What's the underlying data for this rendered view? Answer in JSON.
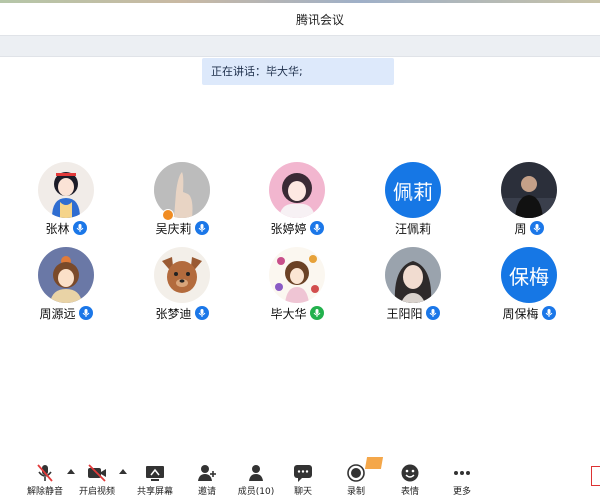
{
  "window": {
    "title": "腾讯会议"
  },
  "speaking": {
    "label": "正在讲话：",
    "names": "毕大华;"
  },
  "participants": [
    {
      "name": "张林",
      "avatar_type": "image",
      "avatar_desc": "cartoon-princess-icon",
      "mic": "on"
    },
    {
      "name": "吴庆莉",
      "avatar_type": "image",
      "avatar_desc": "hand-photo-icon",
      "mic": "on",
      "host": true
    },
    {
      "name": "张婷婷",
      "avatar_type": "image",
      "avatar_desc": "anime-girl-icon",
      "mic": "on"
    },
    {
      "name": "汪佩莉",
      "avatar_type": "text",
      "avatar_text": "佩莉",
      "mic": "none"
    },
    {
      "name": "周",
      "avatar_type": "image",
      "avatar_desc": "person-photo-icon",
      "mic": "on"
    },
    {
      "name": "周源远",
      "avatar_type": "image",
      "avatar_desc": "cartoon-girl-icon",
      "mic": "on"
    },
    {
      "name": "张梦迪",
      "avatar_type": "image",
      "avatar_desc": "cartoon-dog-icon",
      "mic": "on"
    },
    {
      "name": "毕大华",
      "avatar_type": "image",
      "avatar_desc": "flower-girl-icon",
      "mic": "active"
    },
    {
      "name": "王阳阳",
      "avatar_type": "image",
      "avatar_desc": "girl-photo-icon",
      "mic": "on"
    },
    {
      "name": "周保梅",
      "avatar_type": "text",
      "avatar_text": "保梅",
      "mic": "on"
    }
  ],
  "toolbar": {
    "unmute": "解除静音",
    "start_video": "开启视频",
    "share_screen": "共享屏幕",
    "invite": "邀请",
    "members": "成员(10)",
    "chat": "聊天",
    "record": "录制",
    "reactions": "表情",
    "more": "更多"
  },
  "colors": {
    "accent": "#1677e5",
    "speaking_bg": "#dde9fb",
    "active_mic": "#23b14d"
  }
}
